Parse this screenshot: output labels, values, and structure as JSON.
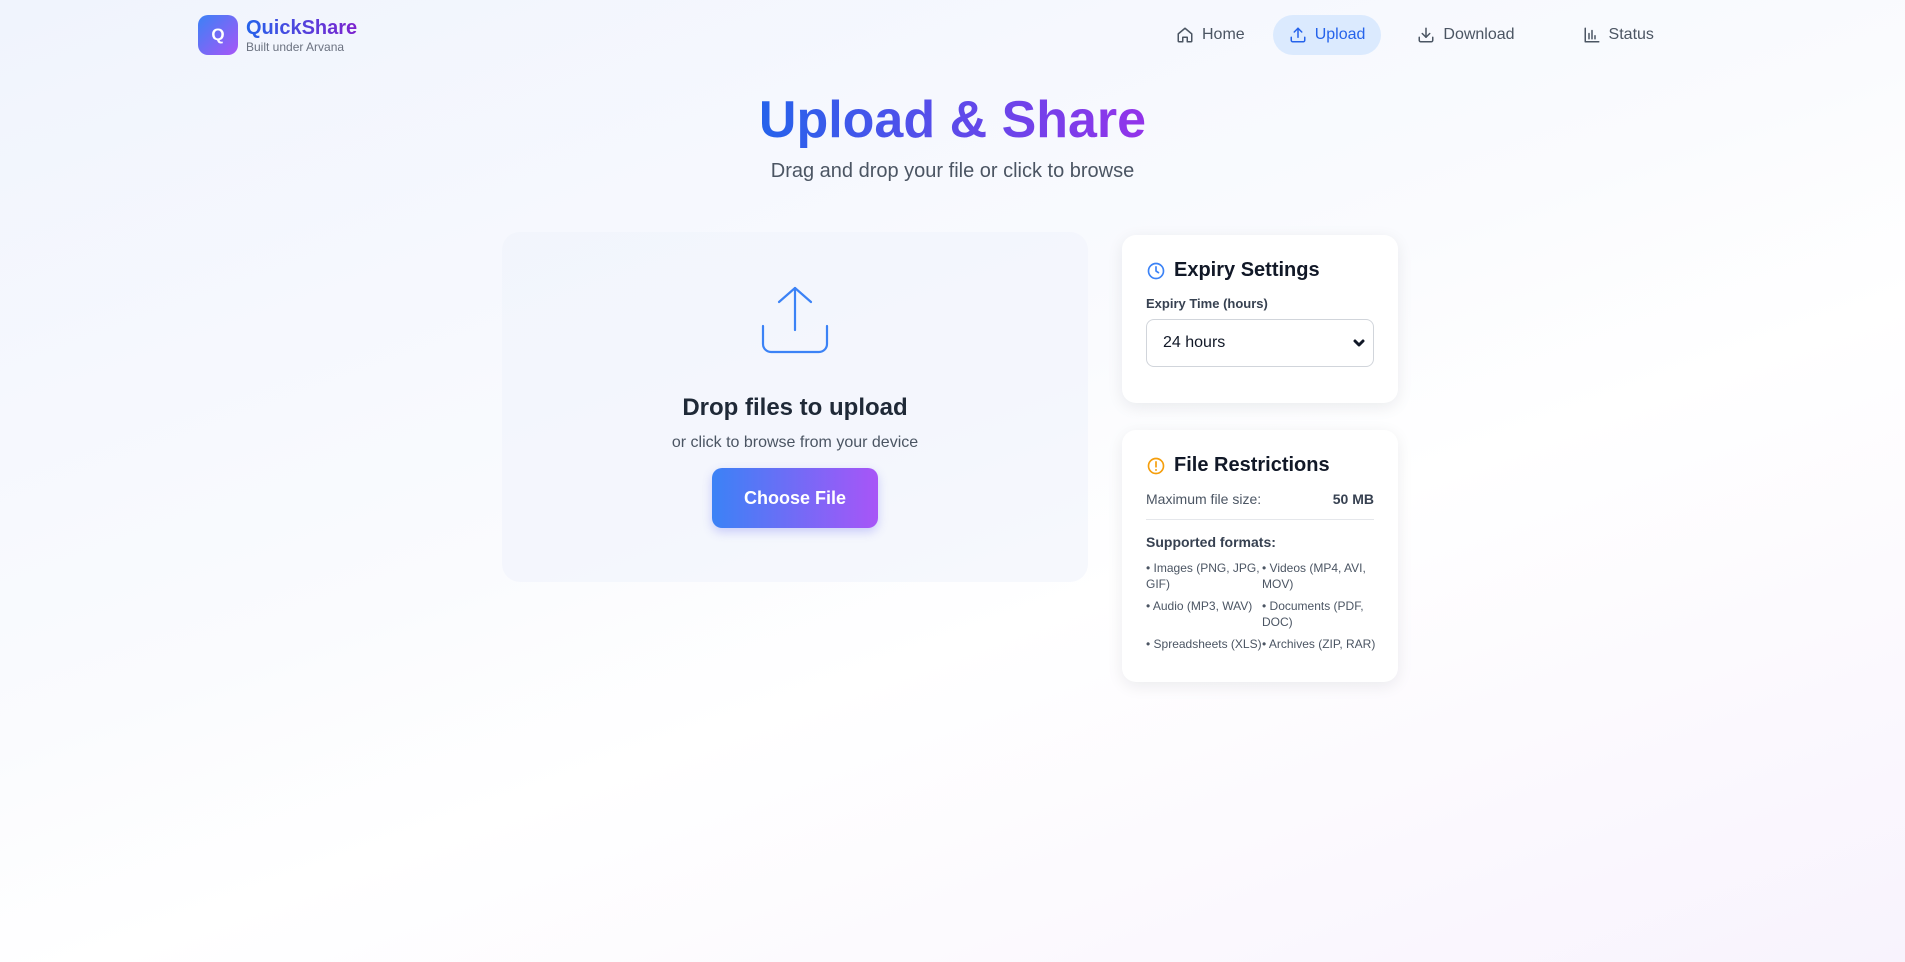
{
  "brand": {
    "badge_letter": "Q",
    "name": "QuickShare",
    "tagline": "Built under Arvana"
  },
  "nav": {
    "items": [
      {
        "label": "Home",
        "icon": "home-icon",
        "active": false
      },
      {
        "label": "Upload",
        "icon": "upload-icon",
        "active": true
      },
      {
        "label": "Download",
        "icon": "download-icon",
        "active": false
      },
      {
        "label": "Status",
        "icon": "bar-chart-icon",
        "active": false
      }
    ]
  },
  "hero": {
    "title": "Upload & Share",
    "subtitle": "Drag and drop your file or click to browse"
  },
  "dropzone": {
    "icon": "upload-arrow-icon",
    "title": "Drop files to upload",
    "subtitle": "or click to browse from your device",
    "button_label": "Choose File"
  },
  "expiry": {
    "icon": "clock-icon",
    "title": "Expiry Settings",
    "field_label": "Expiry Time (hours)",
    "selected": "24 hours"
  },
  "restrictions": {
    "icon": "alert-circle-icon",
    "title": "File Restrictions",
    "max_size_label": "Maximum file size:",
    "max_size_value": "50 MB",
    "formats_label": "Supported formats:",
    "formats": [
      "• Images (PNG, JPG, GIF)",
      "• Videos (MP4, AVI, MOV)",
      "• Audio (MP3, WAV)",
      "• Documents (PDF, DOC)",
      "• Spreadsheets (XLS)",
      "• Archives (ZIP, RAR)"
    ]
  },
  "colors": {
    "accent_blue": "#3b82f6",
    "accent_purple": "#a855f7",
    "nav_active_bg": "#dbeafe",
    "clock_icon": "#3b82f6",
    "warning_icon": "#f59e0b"
  }
}
